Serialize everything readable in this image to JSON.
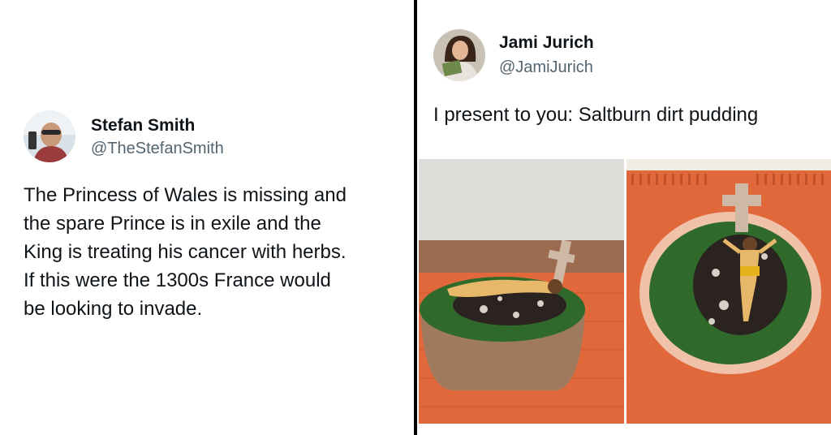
{
  "left_tweet": {
    "author": "Stefan Smith",
    "handle": "@TheStefanSmith",
    "avatar_icon": "profile-photo-man-sunglasses",
    "lines": [
      "The Princess of Wales is missing and",
      "the spare Prince is in exile and the",
      "King is treating his cancer with herbs.",
      "If this were the 1300s France would",
      "be looking to invade."
    ]
  },
  "right_tweet": {
    "author": "Jami Jurich",
    "handle": "@JamiJurich",
    "avatar_icon": "profile-photo-woman-reading",
    "text": "I present to you: Saltburn dirt pudding",
    "photos": [
      {
        "icon": "dirt-pudding-side-view-photo"
      },
      {
        "icon": "dirt-pudding-top-view-photo"
      }
    ]
  },
  "colors": {
    "text": "#0f1419",
    "handle": "#536471",
    "divider": "#000000",
    "grass": "#2f6a2a",
    "table_orange": "#e0683a",
    "figure": "#e8b86a"
  }
}
